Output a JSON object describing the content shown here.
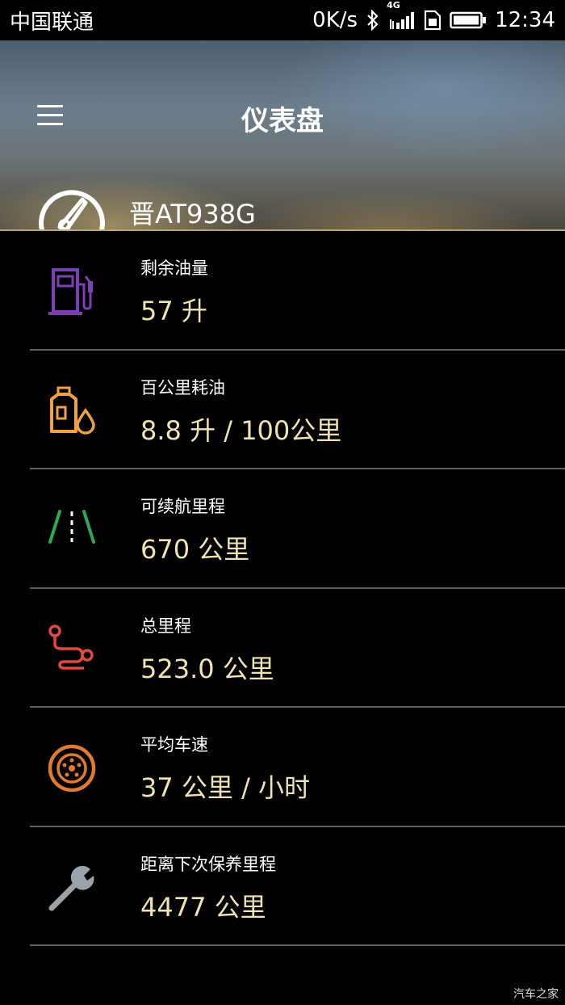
{
  "status_bar": {
    "carrier": "中国联通",
    "net_speed": "0K/s",
    "network_type": "4G",
    "time": "12:34",
    "icons": [
      "bluetooth-icon",
      "signal-icon",
      "sim-icon",
      "battery-icon"
    ]
  },
  "header": {
    "title": "仪表盘",
    "menu_icon": "menu-icon",
    "gauge_icon": "speedometer-icon",
    "plate": "晋AT938G"
  },
  "metrics": [
    {
      "label": "剩余油量",
      "value": "57 升",
      "icon": "fuel-pump-icon",
      "color": "#7b3fb8"
    },
    {
      "label": "百公里耗油",
      "value": "8.8 升 / 100公里",
      "icon": "oil-can-icon",
      "color": "#f0a23c"
    },
    {
      "label": "可续航里程",
      "value": "670 公里",
      "icon": "road-icon",
      "color": "#2fa84f"
    },
    {
      "label": "总里程",
      "value": "523.0 公里",
      "icon": "route-icon",
      "color": "#e04a3c"
    },
    {
      "label": "平均车速",
      "value": "37 公里 / 小时",
      "icon": "wheel-icon",
      "color": "#e07a30"
    },
    {
      "label": "距离下次保养里程",
      "value": "4477 公里",
      "icon": "wrench-icon",
      "color": "#9aa3aa"
    }
  ],
  "colors": {
    "value_text": "#efe3b1",
    "divider": "#5f5f5f",
    "header_accent": "#b9a57a"
  },
  "watermark": "汽车之家"
}
